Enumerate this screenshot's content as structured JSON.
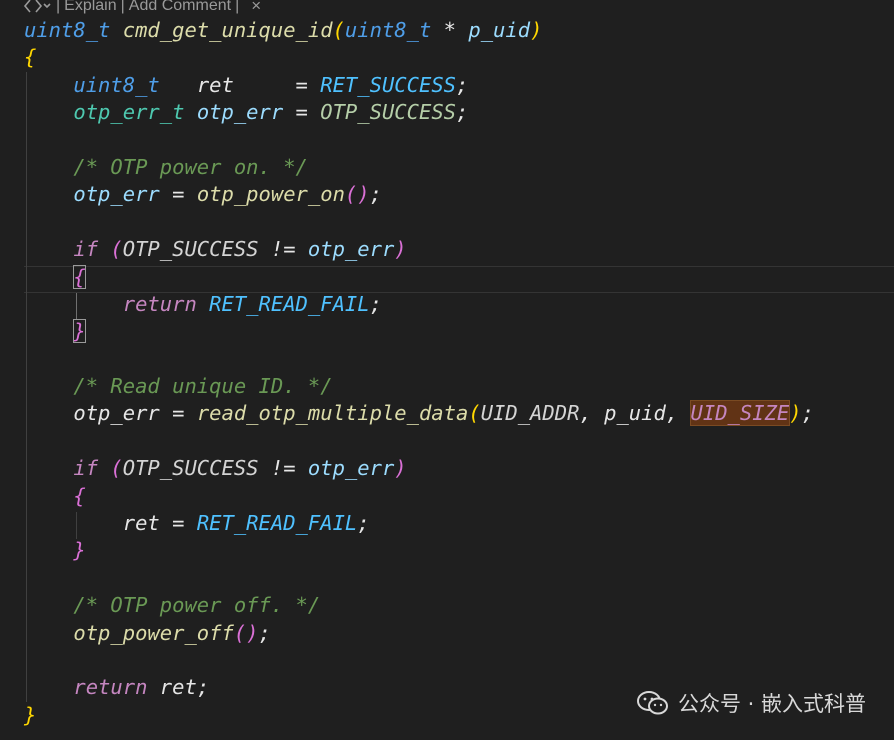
{
  "codelens": {
    "explain_label": "Explain",
    "add_comment_label": "Add Comment",
    "separator": "|",
    "close_glyph": "×",
    "icons": [
      "sparkle-icon",
      "chevron-down-icon",
      "close-icon"
    ]
  },
  "code": {
    "l1": {
      "type": "uint8_t",
      "fn": "cmd_get_unique_id",
      "open": "(",
      "ptype": "uint8_t",
      "star": " * ",
      "param": "p_uid",
      "close": ")"
    },
    "l2": {
      "brace": "{"
    },
    "l3": {
      "type": "uint8_t",
      "pad1": "   ",
      "var": "ret",
      "pad2": "     = ",
      "val": "RET_SUCCESS",
      "semi": ";"
    },
    "l4": {
      "type": "otp_err_t",
      "sp": " ",
      "var": "otp_err",
      "eq": " = ",
      "val": "OTP_SUCCESS",
      "semi": ";"
    },
    "l6": {
      "comment": "/* OTP power on. */"
    },
    "l7": {
      "var": "otp_err",
      "eq": " = ",
      "fn": "otp_power_on",
      "parens": "()",
      "semi": ";"
    },
    "l9": {
      "kw": "if",
      "sp": " ",
      "open": "(",
      "mac": "OTP_SUCCESS",
      "op": " != ",
      "var": "otp_err",
      "close": ")"
    },
    "l10": {
      "brace": "{"
    },
    "l11": {
      "kw": "return",
      "sp": " ",
      "val": "RET_READ_FAIL",
      "semi": ";"
    },
    "l12": {
      "brace": "}"
    },
    "l14": {
      "comment": "/* Read unique ID. */"
    },
    "l15": {
      "var": "otp_err",
      "eq": " = ",
      "fn": "read_otp_multiple_data",
      "open": "(",
      "arg1": "UID_ADDR",
      "c1": ", ",
      "arg2": "p_uid",
      "c2": ", ",
      "arg3": "UID_SIZE",
      "close": ")",
      "semi": ";"
    },
    "l17": {
      "kw": "if",
      "sp": " ",
      "open": "(",
      "mac": "OTP_SUCCESS",
      "op": " != ",
      "var": "otp_err",
      "close": ")"
    },
    "l18": {
      "brace": "{"
    },
    "l19": {
      "var": "ret",
      "eq": " = ",
      "val": "RET_READ_FAIL",
      "semi": ";"
    },
    "l20": {
      "brace": "}"
    },
    "l22": {
      "comment": "/* OTP power off. */"
    },
    "l23": {
      "fn": "otp_power_off",
      "parens": "()",
      "semi": ";"
    },
    "l25": {
      "kw": "return",
      "sp": " ",
      "var": "ret",
      "semi": ";"
    },
    "l26": {
      "brace": "}"
    }
  },
  "colors": {
    "background": "#1f1f1f",
    "type": "#4f9ee8",
    "function": "#dcdcaa",
    "variable": "#9cdcfe",
    "comment": "#6a9955",
    "keyword": "#c586c0",
    "macro": "#4fc1ff",
    "highlight": "#613315"
  },
  "watermark": {
    "text": "公众号 · 嵌入式科普",
    "icon": "wechat-icon"
  }
}
